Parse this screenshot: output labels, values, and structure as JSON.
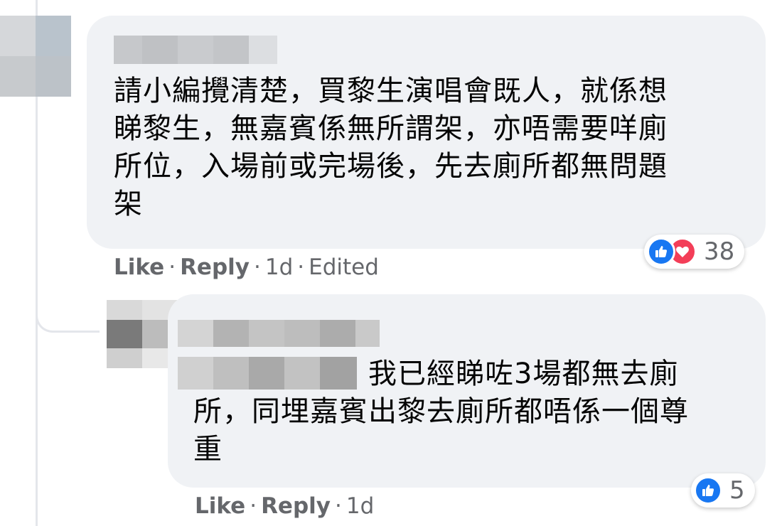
{
  "comment1": {
    "lines": [
      "請小編攪清楚，買黎生演唱會既人，就係想",
      "睇黎生，無嘉賓係無所謂架，亦唔需要咩廁",
      "所位，入場前或完場後，先去廁所都無問題",
      "架"
    ],
    "reactions": {
      "icons": [
        "like-icon",
        "love-icon"
      ],
      "count": "38"
    },
    "actions": {
      "like": "Like",
      "reply": "Reply",
      "time": "1d",
      "edited": "Edited"
    }
  },
  "comment2": {
    "lines": [
      "我已經睇咗3場都無去廁",
      "所，同埋嘉賓出黎去廁所都唔係一個尊",
      "重"
    ],
    "reactions": {
      "icons": [
        "like-icon"
      ],
      "count": "5"
    },
    "actions": {
      "like": "Like",
      "reply": "Reply",
      "time": "1d"
    }
  },
  "colors": {
    "bubble": "#f0f2f5",
    "meta_text": "#65676b",
    "like_blue": "#1877f2",
    "love_red": "#f33e58"
  }
}
